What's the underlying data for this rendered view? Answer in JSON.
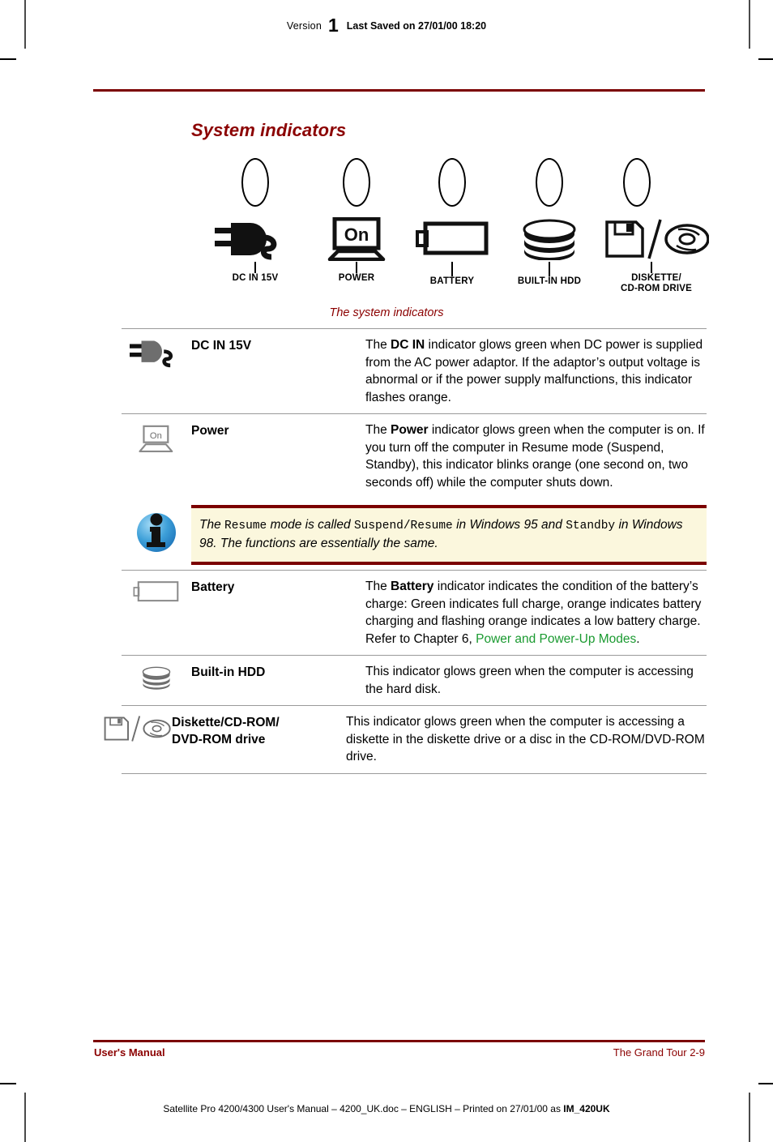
{
  "header": {
    "version_label": "Version",
    "version_number": "1",
    "last_saved": "Last Saved on 27/01/00 18:20"
  },
  "section": {
    "title": "System indicators"
  },
  "figure": {
    "caption": "The system indicators",
    "items": [
      {
        "label": "DC IN 15V",
        "icon": "power-plug-icon"
      },
      {
        "label": "POWER",
        "icon": "laptop-on-icon"
      },
      {
        "label": "BATTERY",
        "icon": "battery-icon"
      },
      {
        "label": "BUILT-IN HDD",
        "icon": "hard-disk-icon"
      },
      {
        "label": "DISKETTE/",
        "label2": "CD-ROM DRIVE",
        "icon": "diskette-cd-icon"
      }
    ]
  },
  "indicators": [
    {
      "icon": "power-plug-icon",
      "term": "DC IN 15V",
      "desc_pre": "The ",
      "desc_bold": "DC IN",
      "desc_post": " indicator glows green when DC power is supplied from the AC power adaptor. If the adaptor’s output voltage is abnormal or if the power supply malfunctions, this indicator flashes orange."
    },
    {
      "icon": "laptop-on-icon",
      "term": "Power",
      "desc_pre": "The ",
      "desc_bold": "Power",
      "desc_post": " indicator glows green when the computer is on. If you turn off the computer in Resume mode (Suspend, Standby), this indicator blinks orange (one second on, two seconds off) while the computer shuts down."
    },
    {
      "icon": "battery-icon",
      "term": "Battery",
      "desc_pre": "The ",
      "desc_bold": "Battery",
      "desc_post": " indicator indicates the condition of the battery’s charge: Green indicates full charge, orange indicates battery charging and flashing orange indicates a low battery charge. Refer to Chapter 6, ",
      "desc_link": "Power and Power-Up Modes",
      "desc_tail": "."
    },
    {
      "icon": "hard-disk-icon",
      "term": "Built-in HDD",
      "desc_pre": "This indicator glows green when the computer is accessing the hard disk.",
      "desc_bold": "",
      "desc_post": ""
    },
    {
      "icon": "diskette-cd-icon",
      "term": "Diskette/CD-ROM/",
      "term2": "DVD-ROM drive",
      "desc_pre": "This indicator glows green when the computer is accessing a diskette in the diskette drive or a disc in the CD-ROM/DVD-ROM drive.",
      "desc_bold": "",
      "desc_post": ""
    }
  ],
  "note": {
    "icon": "info-icon",
    "t1": "The ",
    "m1": "Resume",
    "t2": " mode is called ",
    "m2": "Suspend/Resume",
    "t3": " in Windows 95 and ",
    "m3": "Standby",
    "t4": " in Windows 98. The functions are essentially the same."
  },
  "footer": {
    "left": "User's Manual",
    "right": "The Grand Tour  2-9",
    "print_line_pre": "Satellite Pro 4200/4300 User's Manual  – 4200_UK.doc – ENGLISH – Printed on 27/01/00 as ",
    "print_line_bold": "IM_420UK"
  },
  "colors": {
    "accent_red": "#7b0000",
    "title_red": "#8b0000",
    "link_green": "#1a9a30",
    "note_bg": "#fbf7dd"
  }
}
